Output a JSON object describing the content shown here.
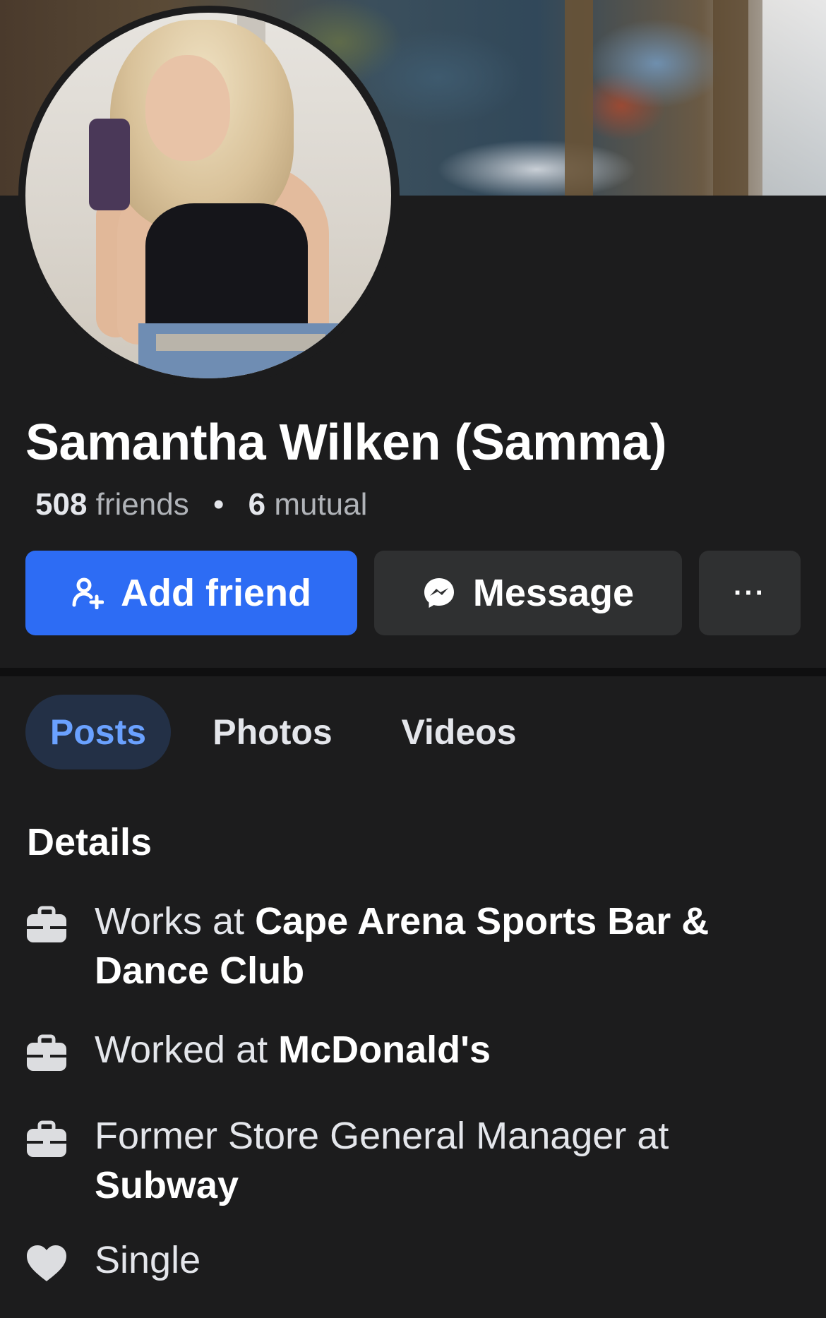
{
  "profile": {
    "name": "Samantha Wilken (Samma)",
    "friends_count": "508",
    "friends_label": "friends",
    "mutual_count": "6",
    "mutual_label": "mutual"
  },
  "actions": {
    "add_friend": "Add friend",
    "message": "Message",
    "more": "···"
  },
  "tabs": [
    {
      "label": "Posts",
      "active": true
    },
    {
      "label": "Photos",
      "active": false
    },
    {
      "label": "Videos",
      "active": false
    }
  ],
  "details": {
    "title": "Details",
    "items": [
      {
        "icon": "briefcase-icon",
        "prefix": "Works at ",
        "bold": "Cape Arena Sports Bar & Dance Club"
      },
      {
        "icon": "briefcase-icon",
        "prefix": "Worked at ",
        "bold": "McDonald's"
      },
      {
        "icon": "briefcase-icon",
        "prefix": "Former Store General Manager at ",
        "bold": "Subway"
      },
      {
        "icon": "heart-icon",
        "prefix": "Single",
        "bold": ""
      }
    ]
  },
  "colors": {
    "background": "#1c1c1d",
    "primary_button": "#2d6cf4",
    "secondary_button": "#2f3031",
    "active_tab_bg": "#233046",
    "active_tab_text": "#6aa1ff"
  }
}
